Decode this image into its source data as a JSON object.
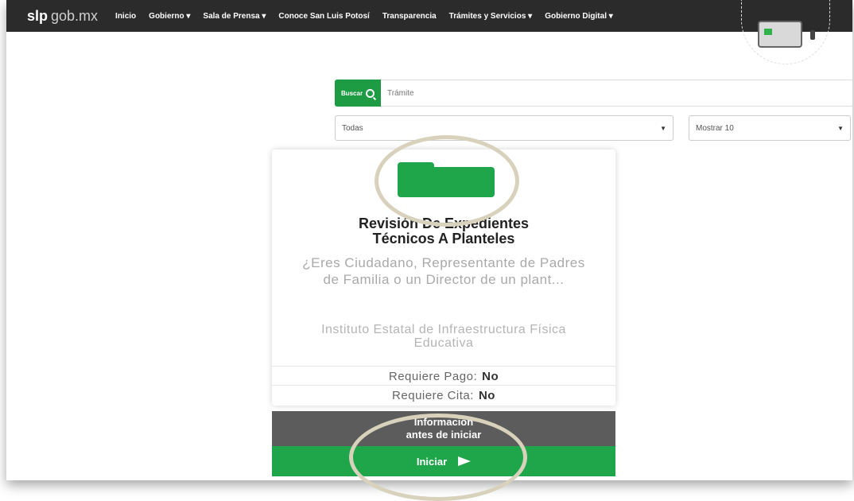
{
  "navbar": {
    "brand_bold": "slp",
    "brand_light": "gob.mx",
    "items": [
      "Inicio",
      "Gobierno ▾",
      "Sala de Prensa ▾",
      "Conoce San Luis Potosí",
      "Transparencia",
      "Trámites y Servicios ▾",
      "Gobierno Digital ▾"
    ]
  },
  "search": {
    "button_label": "Buscar",
    "placeholder": "Trámite"
  },
  "filters": {
    "category_value": "Todas",
    "page_size_value": "Mostrar 10"
  },
  "card": {
    "icon": "folder-icon",
    "title_line1": "Revisión De Expedientes",
    "title_line2": "Técnicos A Planteles",
    "description": "¿Eres Ciudadano, Representante de Padres de Familia o un Director de un plant...",
    "institution": "Instituto Estatal de Infraestructura Física Educativa",
    "payment_label": "Requiere Pago:",
    "payment_value": "No",
    "appointment_label": "Requiere Cita:",
    "appointment_value": "No"
  },
  "actions": {
    "info_line1": "Información",
    "info_line2": "antes de iniciar",
    "start_label": "Iniciar",
    "start_icon": "play-icon"
  },
  "colors": {
    "nav_bg": "#2b2b2b",
    "green": "#20a64a",
    "gray_button": "#5c5c5c",
    "highlight_ring": "#d8d2bd"
  }
}
